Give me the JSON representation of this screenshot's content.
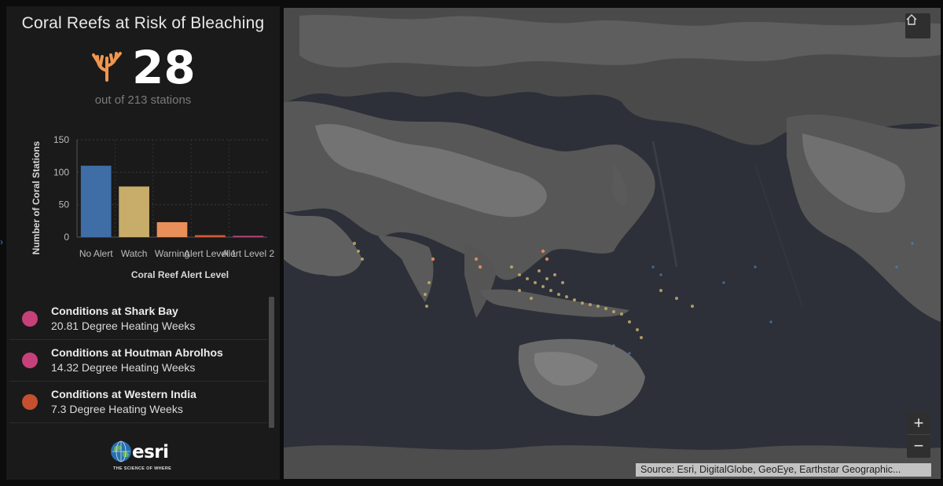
{
  "panel": {
    "title": "Coral Reefs at Risk of Bleaching",
    "indicator_value": "28",
    "indicator_subtitle": "out of 213 stations",
    "icon": "coral-icon"
  },
  "chart_data": {
    "type": "bar",
    "categories": [
      "No Alert",
      "Watch",
      "Warning",
      "Alert Level 1",
      "Alert Level 2"
    ],
    "values": [
      110,
      78,
      23,
      3,
      2
    ],
    "colors": [
      "#3f6ea6",
      "#c8ad6a",
      "#e98f5a",
      "#d15a3a",
      "#b8477a"
    ],
    "xlabel": "Coral Reef Alert Level",
    "ylabel": "Number of Coral Stations",
    "ylim": [
      0,
      150
    ],
    "yticks": [
      0,
      50,
      100,
      150
    ],
    "tick_labels": [
      "No Alert",
      "Watch",
      "Warning",
      "Alert Level 1",
      "Alert Level 2"
    ],
    "grid": true
  },
  "list": {
    "items": [
      {
        "title": "Conditions at Shark Bay",
        "subtitle": "20.81 Degree Heating Weeks",
        "color": "#c7407a"
      },
      {
        "title": "Conditions at Houtman Abrolhos",
        "subtitle": "14.32 Degree Heating Weeks",
        "color": "#c7407a"
      },
      {
        "title": "Conditions at Western India",
        "subtitle": "7.3 Degree Heating Weeks",
        "color": "#c4502f"
      }
    ]
  },
  "branding": {
    "wordmark": "esri",
    "tagline": "THE SCIENCE OF WHERE"
  },
  "map": {
    "home_icon": "home-icon",
    "zoom_in": "+",
    "zoom_out": "−",
    "attribution": "Source: Esri, DigitalGlobe, GeoEye, Earthstar Geographic..."
  }
}
